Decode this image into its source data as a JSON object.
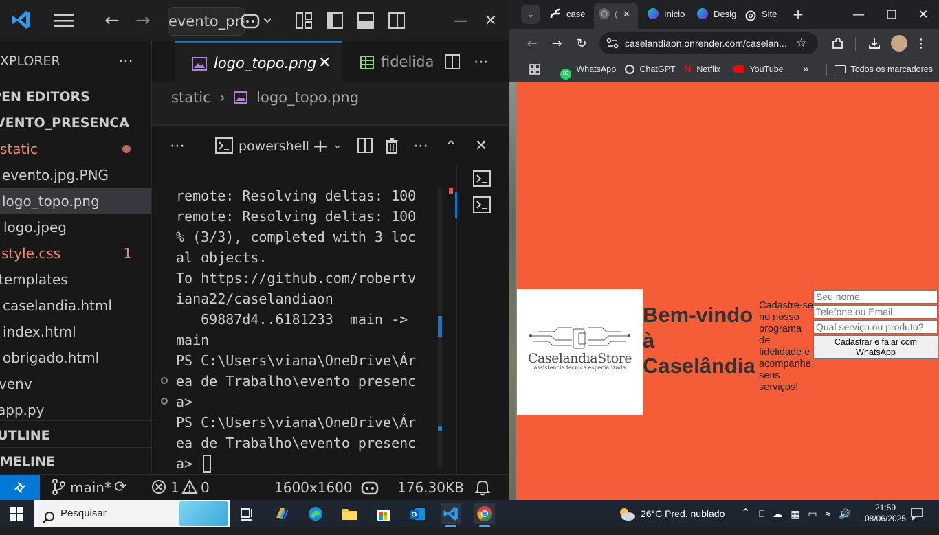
{
  "vscode": {
    "search_text": "evento_presenca",
    "explorer_label": "EXPLORER",
    "open_editors_label": "OPEN EDITORS",
    "project_label": "EVENTO_PRESENCA",
    "tree": [
      {
        "label": "static",
        "color": "#f48771",
        "badge": "dot"
      },
      {
        "label": "evento.jpg.PNG",
        "color": "#cccccc"
      },
      {
        "label": "logo_topo.png",
        "color": "#cccccc",
        "selected": true
      },
      {
        "label": "logo.jpeg",
        "color": "#cccccc"
      },
      {
        "label": "style.css",
        "color": "#f48771",
        "badge": "1"
      },
      {
        "label": "templates",
        "color": "#cccccc"
      },
      {
        "label": "caselandia.html",
        "color": "#cccccc"
      },
      {
        "label": "index.html",
        "color": "#cccccc"
      },
      {
        "label": "obrigado.html",
        "color": "#cccccc"
      },
      {
        "label": "venv",
        "color": "#cccccc"
      },
      {
        "label": "app.py",
        "color": "#cccccc"
      }
    ],
    "outline_label": "OUTLINE",
    "timeline_label": "TIMELINE",
    "tabs": [
      {
        "label": "logo_topo.png",
        "active": true
      },
      {
        "label": "fidelidade",
        "active": false
      }
    ],
    "breadcrumb": {
      "folder": "static",
      "file": "logo_topo.png"
    },
    "terminal_name": "powershell",
    "terminal_lines": [
      "remote: Resolving deltas: 100",
      "remote: Resolving deltas: 100",
      "% (3/3), completed with 3 loc",
      "al objects.",
      "To https://github.com/robertv",
      "iana22/caselandiaon",
      "   69887d4..6181233  main ->",
      "main",
      "PS C:\\Users\\viana\\OneDrive\\Ár",
      "ea de Trabalho\\evento_presenc",
      "a>",
      "PS C:\\Users\\viana\\OneDrive\\Ár",
      "ea de Trabalho\\evento_presenc",
      "a> "
    ],
    "status": {
      "branch": "main*",
      "errors": "1",
      "warnings": "0",
      "dimensions": "1600x1600",
      "filesize": "176.30KB"
    }
  },
  "chrome": {
    "tabs": [
      {
        "label": "case"
      },
      {
        "label": "(",
        "active": true
      },
      {
        "label": "Inicio"
      },
      {
        "label": "Desig"
      },
      {
        "label": "Site"
      }
    ],
    "url": "caselandiaon.onrender.com/caselan...",
    "bookmarks": [
      "WhatsApp",
      "ChatGPT",
      "Netflix",
      "YouTube"
    ],
    "all_bookmarks": "Todos os marcadores",
    "whatsapp_badge": "80"
  },
  "site": {
    "logo_text": "CaselandiaStore",
    "logo_subtext": "assistencia tecnica especializada",
    "welcome": "Bem-vindo à Caselândia",
    "promo": "Cadastre-se no nosso programa de fidelidade e acompanhe seus serviços!",
    "form": {
      "name_placeholder": "Seu nome",
      "contact_placeholder": "Telefone ou Email",
      "service_placeholder": "Qual serviço ou produto?",
      "submit_label": "Cadastrar e falar com WhatsApp"
    },
    "colors": {
      "background": "#f45d37"
    }
  },
  "taskbar": {
    "search_placeholder": "Pesquisar",
    "weather": "26°C  Pred. nublado",
    "time": "21:59",
    "date": "08/06/2025"
  }
}
